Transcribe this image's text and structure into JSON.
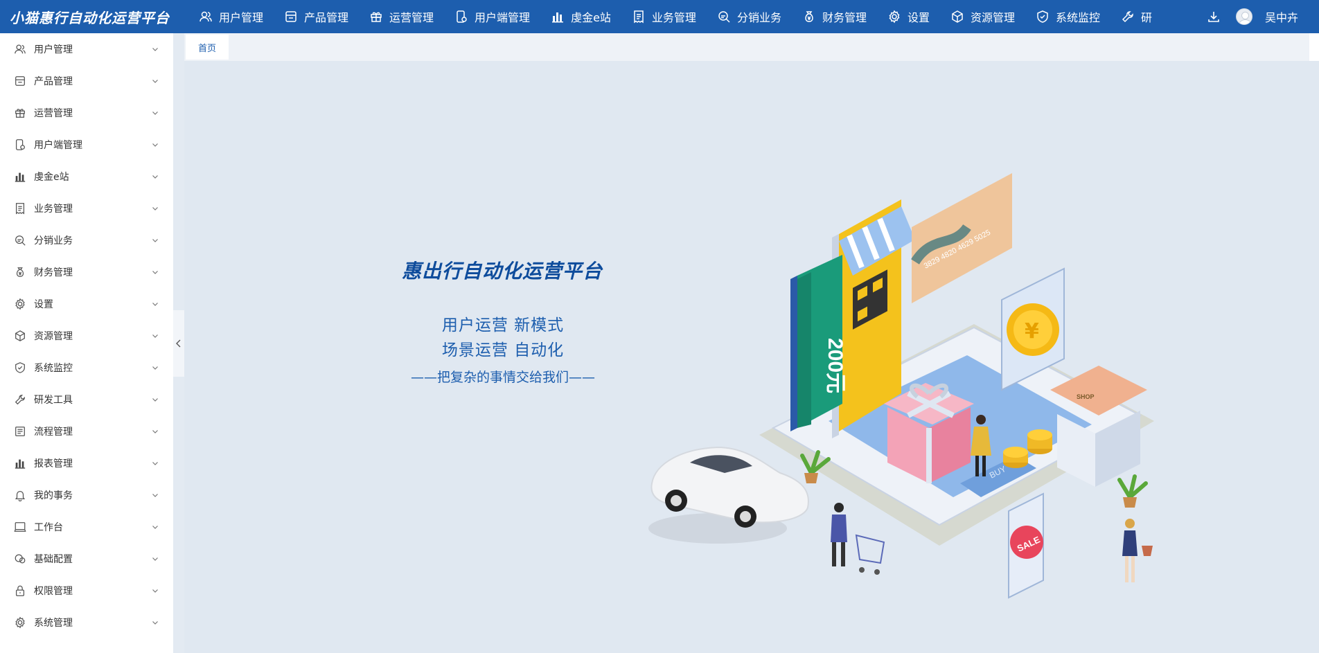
{
  "header": {
    "brand": "小猫惠行自动化运营平台",
    "nav": [
      {
        "label": "用户管理",
        "icon": "user-icon"
      },
      {
        "label": "产品管理",
        "icon": "product-icon"
      },
      {
        "label": "运营管理",
        "icon": "gift-icon"
      },
      {
        "label": "用户端管理",
        "icon": "phone-user-icon"
      },
      {
        "label": "虔金e站",
        "icon": "bar-chart-icon"
      },
      {
        "label": "业务管理",
        "icon": "receipt-icon"
      },
      {
        "label": "分销业务",
        "icon": "search-doc-icon"
      },
      {
        "label": "财务管理",
        "icon": "money-bag-icon"
      },
      {
        "label": "设置",
        "icon": "gear-icon"
      },
      {
        "label": "资源管理",
        "icon": "cube-icon"
      },
      {
        "label": "系统监控",
        "icon": "shield-icon"
      },
      {
        "label": "研",
        "icon": "wrench-icon"
      }
    ],
    "username": "吴中卉"
  },
  "sidebar": {
    "items": [
      {
        "label": "用户管理",
        "icon": "user-icon"
      },
      {
        "label": "产品管理",
        "icon": "product-icon"
      },
      {
        "label": "运营管理",
        "icon": "gift-icon"
      },
      {
        "label": "用户端管理",
        "icon": "phone-user-icon"
      },
      {
        "label": "虔金e站",
        "icon": "bar-chart-icon"
      },
      {
        "label": "业务管理",
        "icon": "receipt-icon"
      },
      {
        "label": "分销业务",
        "icon": "search-doc-icon"
      },
      {
        "label": "财务管理",
        "icon": "money-bag-icon"
      },
      {
        "label": "设置",
        "icon": "gear-icon"
      },
      {
        "label": "资源管理",
        "icon": "cube-icon"
      },
      {
        "label": "系统监控",
        "icon": "shield-icon"
      },
      {
        "label": "研发工具",
        "icon": "wrench-icon"
      },
      {
        "label": "流程管理",
        "icon": "list-icon"
      },
      {
        "label": "报表管理",
        "icon": "bar-chart-icon"
      },
      {
        "label": "我的事务",
        "icon": "bell-icon"
      },
      {
        "label": "工作台",
        "icon": "monitor-icon"
      },
      {
        "label": "基础配置",
        "icon": "chat-icon"
      },
      {
        "label": "权限管理",
        "icon": "lock-icon"
      },
      {
        "label": "系统管理",
        "icon": "gear-icon"
      }
    ]
  },
  "tabs": [
    {
      "label": "首页"
    }
  ],
  "hero": {
    "title": "惠出行自动化运营平台",
    "line1": "用户运营  新模式",
    "line2": "场景运营  自动化",
    "tagline": "——把复杂的事情交给我们——"
  },
  "illustration": {
    "coupon_text": "200元",
    "card_number": "3829 4820 4629 5025",
    "sale_text": "SALE",
    "shop_text": "SHOP",
    "buy_text": "BUY"
  },
  "colors": {
    "header_bg": "#1d5eae",
    "content_bg": "#e0e8f1",
    "accent_text": "#1d5eae",
    "coupon_green": "#1a9b7a",
    "phone_yellow": "#f4c21c"
  }
}
